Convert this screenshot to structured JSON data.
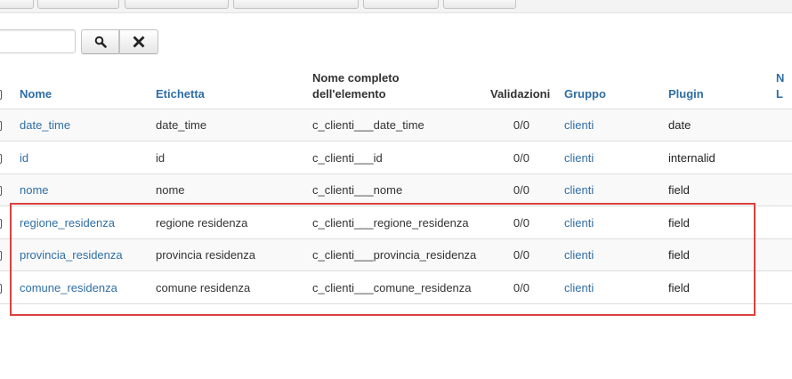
{
  "search": {
    "value": "",
    "placeholder": ""
  },
  "buttons": {
    "search_icon": "search-icon",
    "clear_icon": "close-icon"
  },
  "columns": {
    "name": "Nome",
    "label": "Etichetta",
    "full_name_line1": "Nome completo",
    "full_name_line2": "dell'elemento",
    "validations": "Validazioni",
    "group": "Gruppo",
    "plugin": "Plugin",
    "cut_top": "N",
    "cut_bottom": "L"
  },
  "rows": [
    {
      "name": "date_time",
      "label": "date_time",
      "full_name": "c_clienti___date_time",
      "validations": "0/0",
      "group": "clienti",
      "plugin": "date"
    },
    {
      "name": "id",
      "label": "id",
      "full_name": "c_clienti___id",
      "validations": "0/0",
      "group": "clienti",
      "plugin": "internalid"
    },
    {
      "name": "nome",
      "label": "nome",
      "full_name": "c_clienti___nome",
      "validations": "0/0",
      "group": "clienti",
      "plugin": "field"
    },
    {
      "name": "regione_residenza",
      "label": "regione residenza",
      "full_name": "c_clienti___regione_residenza",
      "validations": "0/0",
      "group": "clienti",
      "plugin": "field"
    },
    {
      "name": "provincia_residenza",
      "label": "provincia residenza",
      "full_name": "c_clienti___provincia_residenza",
      "validations": "0/0",
      "group": "clienti",
      "plugin": "field"
    },
    {
      "name": "comune_residenza",
      "label": "comune residenza",
      "full_name": "c_clienti___comune_residenza",
      "validations": "0/0",
      "group": "clienti",
      "plugin": "field"
    }
  ],
  "colors": {
    "link": "#2f6ea5",
    "highlight": "#d9413d"
  }
}
